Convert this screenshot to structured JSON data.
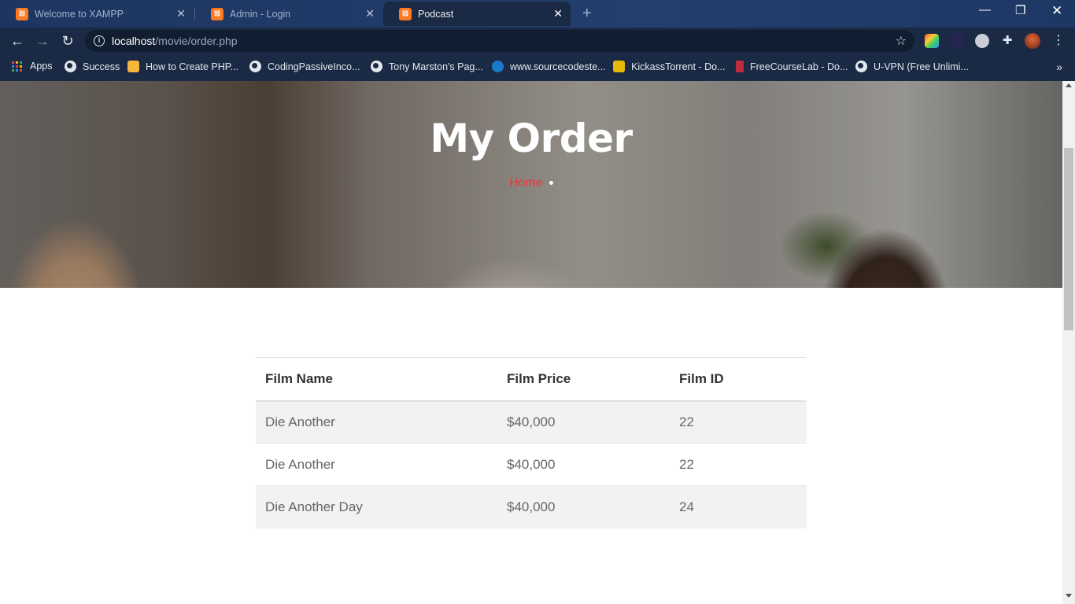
{
  "browser": {
    "tabs": [
      {
        "title": "Welcome to XAMPP",
        "active": false
      },
      {
        "title": "Admin - Login",
        "active": false
      },
      {
        "title": "Podcast",
        "active": true
      }
    ],
    "url_host": "localhost",
    "url_path": "/movie/order.php",
    "bookmarks": [
      {
        "label": "Apps",
        "icon": "apps-grid-icon"
      },
      {
        "label": "Success",
        "icon": "globe-icon"
      },
      {
        "label": "How to Create PHP...",
        "icon": "bookmark-icon"
      },
      {
        "label": "CodingPassiveInco...",
        "icon": "globe-icon"
      },
      {
        "label": "Tony Marston's Pag...",
        "icon": "globe-icon"
      },
      {
        "label": "www.sourcecodeste...",
        "icon": "drupal-icon"
      },
      {
        "label": "KickassTorrent - Do...",
        "icon": "kat-icon"
      },
      {
        "label": "FreeCourseLab - Do...",
        "icon": "bookmark-icon"
      },
      {
        "label": "U-VPN (Free Unlimi...",
        "icon": "globe-icon"
      }
    ]
  },
  "hero": {
    "title": "My Order",
    "breadcrumb_home": "Home"
  },
  "orders": {
    "headers": [
      "Film Name",
      "Film Price",
      "Film ID"
    ],
    "rows": [
      {
        "name": "Die Another",
        "price": "$40,000",
        "id": "22"
      },
      {
        "name": "Die Another",
        "price": "$40,000",
        "id": "22"
      },
      {
        "name": "Die Another Day",
        "price": "$40,000",
        "id": "24"
      }
    ]
  },
  "colors": {
    "accent": "#e83a3a",
    "chrome": "#1b2a44",
    "xampp": "#fb7a24"
  }
}
